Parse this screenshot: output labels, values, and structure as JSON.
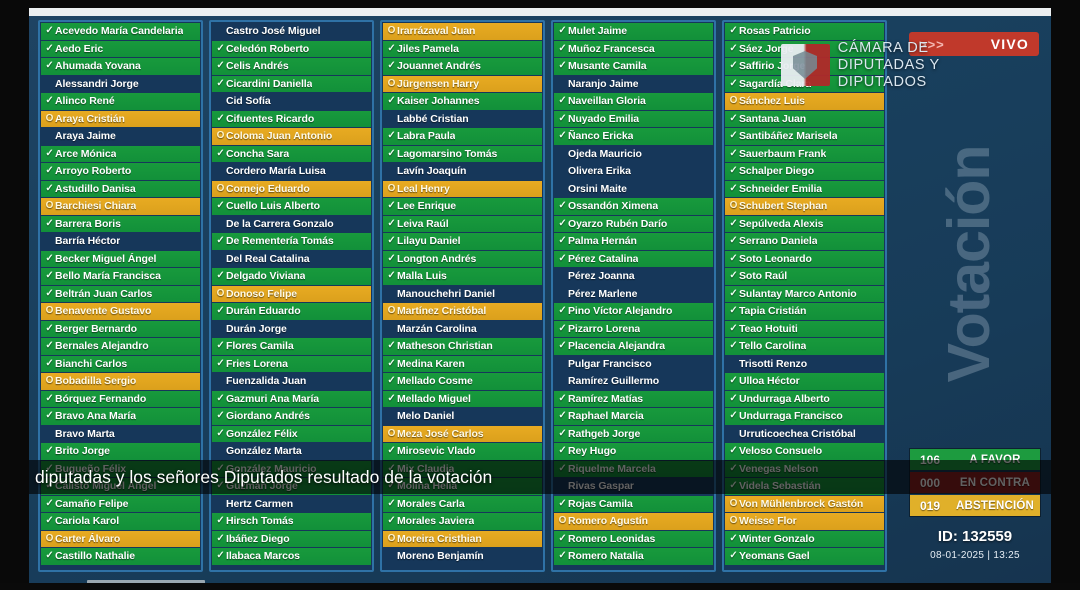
{
  "broadcast": {
    "live_badge": {
      "chevrons": ">>>",
      "label": "VIVO"
    },
    "channel_logo": {
      "line1": "CÁMARA DE",
      "line2": "DIPUTADAS Y DIPUTADOS",
      "crest": "chile-coat-of-arms"
    },
    "watermark": "Votación",
    "caption": "diputadas y los señores Diputados resultado de la votación"
  },
  "tally": {
    "favor": {
      "count": "106",
      "label": "A FAVOR",
      "color": "#1d9b3f"
    },
    "contra": {
      "count": "000",
      "label": "EN CONTRA",
      "color": "#8e2020"
    },
    "abstencion": {
      "count": "019",
      "label": "ABSTENCIÓN",
      "color": "#e0b02a"
    }
  },
  "session": {
    "id_label": "ID: 132559",
    "datetime": "08-01-2025  |  13:25"
  },
  "marks": {
    "favor": "✓",
    "abstencion": "O",
    "none": ""
  },
  "columns": [
    [
      {
        "name": "Acevedo María Candelaria",
        "vote": "favor"
      },
      {
        "name": "Aedo Eric",
        "vote": "favor"
      },
      {
        "name": "Ahumada Yovana",
        "vote": "favor"
      },
      {
        "name": "Alessandri Jorge",
        "vote": "none"
      },
      {
        "name": "Alinco René",
        "vote": "favor"
      },
      {
        "name": "Araya Cristián",
        "vote": "abstencion"
      },
      {
        "name": "Araya Jaime",
        "vote": "none"
      },
      {
        "name": "Arce Mónica",
        "vote": "favor"
      },
      {
        "name": "Arroyo Roberto",
        "vote": "favor"
      },
      {
        "name": "Astudillo Danisa",
        "vote": "favor"
      },
      {
        "name": "Barchiesi Chiara",
        "vote": "abstencion"
      },
      {
        "name": "Barrera Boris",
        "vote": "favor"
      },
      {
        "name": "Barría Héctor",
        "vote": "none"
      },
      {
        "name": "Becker Miguel Ángel",
        "vote": "favor"
      },
      {
        "name": "Bello María Francisca",
        "vote": "favor"
      },
      {
        "name": "Beltrán Juan Carlos",
        "vote": "favor"
      },
      {
        "name": "Benavente Gustavo",
        "vote": "abstencion"
      },
      {
        "name": "Berger Bernardo",
        "vote": "favor"
      },
      {
        "name": "Bernales Alejandro",
        "vote": "favor"
      },
      {
        "name": "Bianchi Carlos",
        "vote": "favor"
      },
      {
        "name": "Bobadilla Sergio",
        "vote": "abstencion"
      },
      {
        "name": "Bórquez Fernando",
        "vote": "favor"
      },
      {
        "name": "Bravo Ana María",
        "vote": "favor"
      },
      {
        "name": "Bravo Marta",
        "vote": "none"
      },
      {
        "name": "Brito Jorge",
        "vote": "favor"
      },
      {
        "name": "Bugueño Félix",
        "vote": "favor"
      },
      {
        "name": "Calisto Miguel Ángel",
        "vote": "favor"
      },
      {
        "name": "Camaño Felipe",
        "vote": "favor"
      },
      {
        "name": "Cariola Karol",
        "vote": "favor"
      },
      {
        "name": "Carter Álvaro",
        "vote": "abstencion"
      },
      {
        "name": "Castillo Nathalie",
        "vote": "favor"
      }
    ],
    [
      {
        "name": "Castro José Miguel",
        "vote": "none"
      },
      {
        "name": "Celedón Roberto",
        "vote": "favor"
      },
      {
        "name": "Celis Andrés",
        "vote": "favor"
      },
      {
        "name": "Cicardini Daniella",
        "vote": "favor"
      },
      {
        "name": "Cid Sofía",
        "vote": "none"
      },
      {
        "name": "Cifuentes Ricardo",
        "vote": "favor"
      },
      {
        "name": "Coloma Juan Antonio",
        "vote": "abstencion"
      },
      {
        "name": "Concha Sara",
        "vote": "favor"
      },
      {
        "name": "Cordero María Luisa",
        "vote": "none"
      },
      {
        "name": "Cornejo Eduardo",
        "vote": "abstencion"
      },
      {
        "name": "Cuello Luis Alberto",
        "vote": "favor"
      },
      {
        "name": "De la Carrera Gonzalo",
        "vote": "none"
      },
      {
        "name": "De Rementería Tomás",
        "vote": "favor"
      },
      {
        "name": "Del Real Catalina",
        "vote": "none"
      },
      {
        "name": "Delgado Viviana",
        "vote": "favor"
      },
      {
        "name": "Donoso Felipe",
        "vote": "abstencion"
      },
      {
        "name": "Durán Eduardo",
        "vote": "favor"
      },
      {
        "name": "Durán Jorge",
        "vote": "none"
      },
      {
        "name": "Flores Camila",
        "vote": "favor"
      },
      {
        "name": "Fries Lorena",
        "vote": "favor"
      },
      {
        "name": "Fuenzalida Juan",
        "vote": "none"
      },
      {
        "name": "Gazmuri Ana María",
        "vote": "favor"
      },
      {
        "name": "Giordano Andrés",
        "vote": "favor"
      },
      {
        "name": "González Félix",
        "vote": "favor"
      },
      {
        "name": "González Marta",
        "vote": "none"
      },
      {
        "name": "González Mauricio",
        "vote": "favor"
      },
      {
        "name": "Guzmán Jorge",
        "vote": "favor"
      },
      {
        "name": "Hertz Carmen",
        "vote": "none"
      },
      {
        "name": "Hirsch Tomás",
        "vote": "favor"
      },
      {
        "name": "Ibáñez Diego",
        "vote": "favor"
      },
      {
        "name": "Ilabaca Marcos",
        "vote": "favor"
      }
    ],
    [
      {
        "name": "Irarrázaval Juan",
        "vote": "abstencion"
      },
      {
        "name": "Jiles Pamela",
        "vote": "favor"
      },
      {
        "name": "Jouannet Andrés",
        "vote": "favor"
      },
      {
        "name": "Jürgensen Harry",
        "vote": "abstencion"
      },
      {
        "name": "Kaiser Johannes",
        "vote": "favor"
      },
      {
        "name": "Labbé Cristian",
        "vote": "none"
      },
      {
        "name": "Labra Paula",
        "vote": "favor"
      },
      {
        "name": "Lagomarsino Tomás",
        "vote": "favor"
      },
      {
        "name": "Lavín Joaquín",
        "vote": "none"
      },
      {
        "name": "Leal Henry",
        "vote": "abstencion"
      },
      {
        "name": "Lee Enrique",
        "vote": "favor"
      },
      {
        "name": "Leiva Raúl",
        "vote": "favor"
      },
      {
        "name": "Lilayu Daniel",
        "vote": "favor"
      },
      {
        "name": "Longton Andrés",
        "vote": "favor"
      },
      {
        "name": "Malla Luis",
        "vote": "favor"
      },
      {
        "name": "Manouchehri Daniel",
        "vote": "none"
      },
      {
        "name": "Martínez Cristóbal",
        "vote": "abstencion"
      },
      {
        "name": "Marzán Carolina",
        "vote": "none"
      },
      {
        "name": "Matheson Christian",
        "vote": "favor"
      },
      {
        "name": "Medina Karen",
        "vote": "favor"
      },
      {
        "name": "Mellado Cosme",
        "vote": "favor"
      },
      {
        "name": "Mellado Miguel",
        "vote": "favor"
      },
      {
        "name": "Melo Daniel",
        "vote": "none"
      },
      {
        "name": "Meza José Carlos",
        "vote": "abstencion"
      },
      {
        "name": "Mirosevic Vlado",
        "vote": "favor"
      },
      {
        "name": "Mix Claudia",
        "vote": "favor"
      },
      {
        "name": "Molina Helia",
        "vote": "favor"
      },
      {
        "name": "Morales Carla",
        "vote": "favor"
      },
      {
        "name": "Morales Javiera",
        "vote": "favor"
      },
      {
        "name": "Moreira Cristhian",
        "vote": "abstencion"
      },
      {
        "name": "Moreno Benjamín",
        "vote": "none"
      }
    ],
    [
      {
        "name": "Mulet Jaime",
        "vote": "favor"
      },
      {
        "name": "Muñoz Francesca",
        "vote": "favor"
      },
      {
        "name": "Musante Camila",
        "vote": "favor"
      },
      {
        "name": "Naranjo Jaime",
        "vote": "none"
      },
      {
        "name": "Naveillan Gloria",
        "vote": "favor"
      },
      {
        "name": "Nuyado Emilia",
        "vote": "favor"
      },
      {
        "name": "Ñanco Ericka",
        "vote": "favor"
      },
      {
        "name": "Ojeda Mauricio",
        "vote": "none"
      },
      {
        "name": "Olivera Erika",
        "vote": "none"
      },
      {
        "name": "Orsini Maite",
        "vote": "none"
      },
      {
        "name": "Ossandón Ximena",
        "vote": "favor"
      },
      {
        "name": "Oyarzo Rubén Darío",
        "vote": "favor"
      },
      {
        "name": "Palma Hernán",
        "vote": "favor"
      },
      {
        "name": "Pérez Catalina",
        "vote": "favor"
      },
      {
        "name": "Pérez Joanna",
        "vote": "none"
      },
      {
        "name": "Pérez Marlene",
        "vote": "none"
      },
      {
        "name": "Pino Víctor Alejandro",
        "vote": "favor"
      },
      {
        "name": "Pizarro Lorena",
        "vote": "favor"
      },
      {
        "name": "Placencia Alejandra",
        "vote": "favor"
      },
      {
        "name": "Pulgar Francisco",
        "vote": "none"
      },
      {
        "name": "Ramírez Guillermo",
        "vote": "none"
      },
      {
        "name": "Ramírez Matías",
        "vote": "favor"
      },
      {
        "name": "Raphael Marcia",
        "vote": "favor"
      },
      {
        "name": "Rathgeb Jorge",
        "vote": "favor"
      },
      {
        "name": "Rey Hugo",
        "vote": "favor"
      },
      {
        "name": "Riquelme Marcela",
        "vote": "favor"
      },
      {
        "name": "Rivas Gaspar",
        "vote": "none"
      },
      {
        "name": "Rojas Camila",
        "vote": "favor"
      },
      {
        "name": "Romero Agustín",
        "vote": "abstencion"
      },
      {
        "name": "Romero Leonidas",
        "vote": "favor"
      },
      {
        "name": "Romero Natalia",
        "vote": "favor"
      }
    ],
    [
      {
        "name": "Rosas Patricio",
        "vote": "favor"
      },
      {
        "name": "Sáez Jorge",
        "vote": "favor"
      },
      {
        "name": "Saffirio Jorge",
        "vote": "favor"
      },
      {
        "name": "Sagardía Clara",
        "vote": "favor"
      },
      {
        "name": "Sánchez Luis",
        "vote": "abstencion"
      },
      {
        "name": "Santana Juan",
        "vote": "favor"
      },
      {
        "name": "Santibáñez Marisela",
        "vote": "favor"
      },
      {
        "name": "Sauerbaum Frank",
        "vote": "favor"
      },
      {
        "name": "Schalper Diego",
        "vote": "favor"
      },
      {
        "name": "Schneider Emilia",
        "vote": "favor"
      },
      {
        "name": "Schubert Stephan",
        "vote": "abstencion"
      },
      {
        "name": "Sepúlveda Alexis",
        "vote": "favor"
      },
      {
        "name": "Serrano Daniela",
        "vote": "favor"
      },
      {
        "name": "Soto Leonardo",
        "vote": "favor"
      },
      {
        "name": "Soto Raúl",
        "vote": "favor"
      },
      {
        "name": "Sulantay Marco Antonio",
        "vote": "favor"
      },
      {
        "name": "Tapia Cristián",
        "vote": "favor"
      },
      {
        "name": "Teao Hotuiti",
        "vote": "favor"
      },
      {
        "name": "Tello Carolina",
        "vote": "favor"
      },
      {
        "name": "Trisotti Renzo",
        "vote": "none"
      },
      {
        "name": "Ulloa Héctor",
        "vote": "favor"
      },
      {
        "name": "Undurraga Alberto",
        "vote": "favor"
      },
      {
        "name": "Undurraga Francisco",
        "vote": "favor"
      },
      {
        "name": "Urruticoechea Cristóbal",
        "vote": "none"
      },
      {
        "name": "Veloso Consuelo",
        "vote": "favor"
      },
      {
        "name": "Venegas Nelson",
        "vote": "favor"
      },
      {
        "name": "Videla Sebastián",
        "vote": "favor"
      },
      {
        "name": "Von Mühlenbrock Gastón",
        "vote": "abstencion"
      },
      {
        "name": "Weisse Flor",
        "vote": "abstencion"
      },
      {
        "name": "Winter Gonzalo",
        "vote": "favor"
      },
      {
        "name": "Yeomans Gael",
        "vote": "favor"
      }
    ]
  ]
}
